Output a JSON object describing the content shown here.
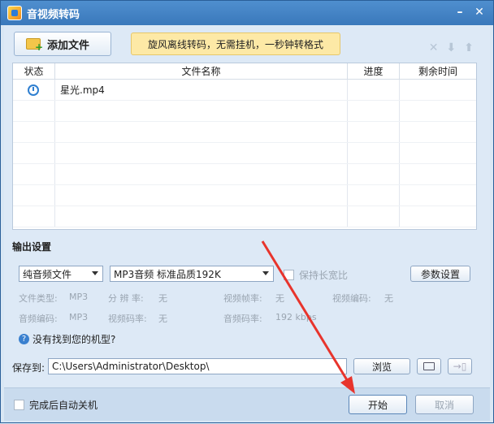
{
  "window": {
    "title": "音视频转码"
  },
  "toolbar": {
    "add_file_label": "添加文件",
    "banner_text": "旋风离线转码，无需挂机，一秒钟转格式"
  },
  "table": {
    "headers": [
      "状态",
      "文件名称",
      "进度",
      "剩余时间"
    ],
    "rows": [
      {
        "file_name": "星光.mp4",
        "progress": "",
        "remaining": ""
      }
    ]
  },
  "output": {
    "section_title": "输出设置",
    "format_select": "纯音频文件",
    "quality_select": "MP3音频 标准品质192K",
    "keep_ratio_label": "保持长宽比",
    "params_button": "参数设置",
    "specs": {
      "file_type_label": "文件类型:",
      "file_type_value": "MP3",
      "resolution_label": "分 辨 率:",
      "resolution_value": "无",
      "video_fps_label": "视频帧率:",
      "video_fps_value": "无",
      "video_codec_label": "视频编码:",
      "video_codec_value": "无",
      "audio_codec_label": "音频编码:",
      "audio_codec_value": "MP3",
      "video_bitrate_label": "视频码率:",
      "video_bitrate_value": "无",
      "audio_bitrate_label": "音频码率:",
      "audio_bitrate_value": "192 kbps"
    },
    "help_text": "没有找到您的机型?"
  },
  "save": {
    "label": "保存到:",
    "path": "C:\\Users\\Administrator\\Desktop\\",
    "browse_label": "浏览"
  },
  "footer": {
    "shutdown_label": "完成后自动关机",
    "start_label": "开始",
    "cancel_label": "取消"
  },
  "colors": {
    "accent": "#3a78bb",
    "banner": "#fde9a6",
    "arrow": "#e8342c"
  }
}
